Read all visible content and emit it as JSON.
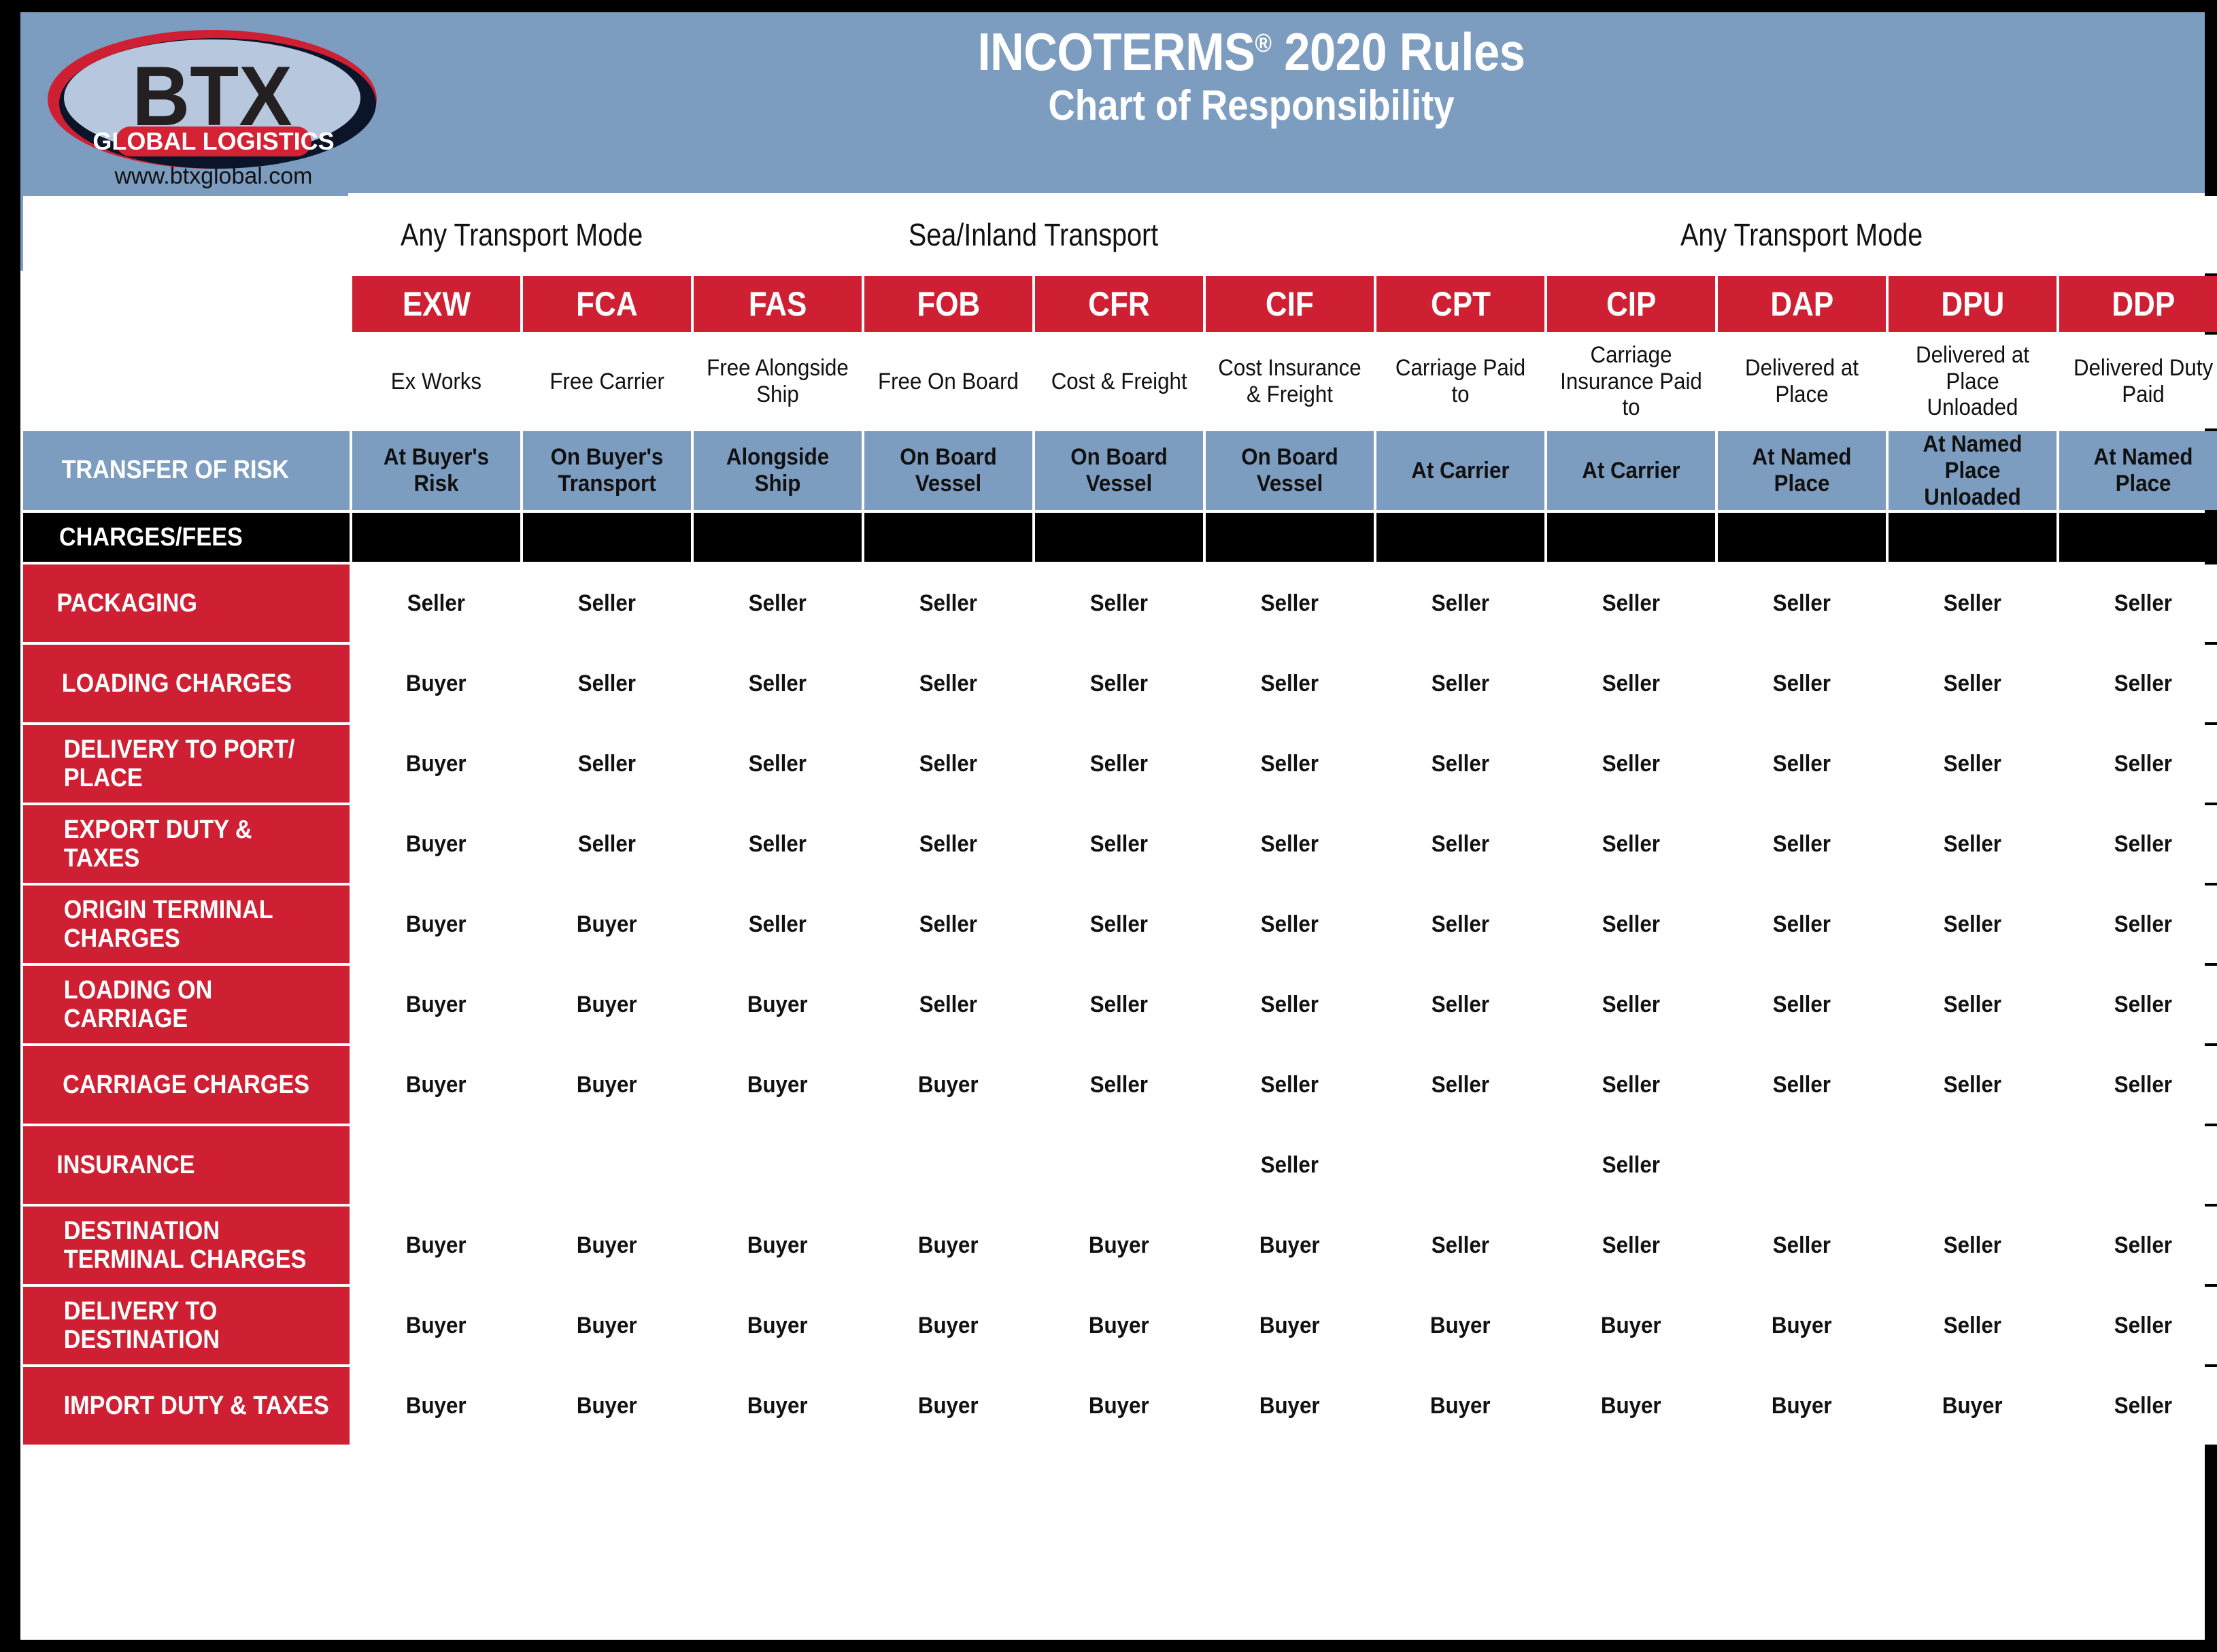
{
  "brand": {
    "name": "BTX",
    "tagline": "GLOBAL LOGISTICS",
    "website": "www.btxglobal.com",
    "colors": {
      "red": "#cf1f32",
      "navy": "#0b1428",
      "blue": "#7d9dc0",
      "gray": "#929497",
      "dark": "#404040"
    }
  },
  "header": {
    "title": "INCOTERMS",
    "title_sup": "®",
    "title_year": " 2020 Rules",
    "subtitle": "Chart of Responsibility"
  },
  "chart_data": {
    "type": "table",
    "title": "INCOTERMS® 2020 Rules — Chart of Responsibility",
    "groups": [
      {
        "label": "Any Transport Mode",
        "span": 2
      },
      {
        "label": "Sea/Inland Transport",
        "span": 4
      },
      {
        "label": "Any Transport Mode",
        "span": 5
      }
    ],
    "codes": [
      "EXW",
      "FCA",
      "FAS",
      "FOB",
      "CFR",
      "CIF",
      "CPT",
      "CIP",
      "DAP",
      "DPU",
      "DDP"
    ],
    "names": [
      "Ex Works",
      "Free Carrier",
      "Free Alongside Ship",
      "Free On Board",
      "Cost & Freight",
      "Cost Insurance & Freight",
      "Carriage Paid to",
      "Carriage Insurance Paid to",
      "Delivered at Place",
      "Delivered at Place Unloaded",
      "Delivered Duty Paid"
    ],
    "transfer_of_risk_label": "TRANSFER OF RISK",
    "transfer_of_risk": [
      "At Buyer's Risk",
      "On Buyer's Transport",
      "Alongside Ship",
      "On Board Vessel",
      "On Board Vessel",
      "On Board Vessel",
      "At Carrier",
      "At Carrier",
      "At Named Place",
      "At Named Place Unloaded",
      "At Named Place"
    ],
    "section_label": "CHARGES/FEES",
    "rows": [
      {
        "label": "PACKAGING",
        "values": [
          "Seller",
          "Seller",
          "Seller",
          "Seller",
          "Seller",
          "Seller",
          "Seller",
          "Seller",
          "Seller",
          "Seller",
          "Seller"
        ]
      },
      {
        "label": "LOADING CHARGES",
        "values": [
          "Buyer",
          "Seller",
          "Seller",
          "Seller",
          "Seller",
          "Seller",
          "Seller",
          "Seller",
          "Seller",
          "Seller",
          "Seller"
        ]
      },
      {
        "label": "DELIVERY TO PORT/ PLACE",
        "values": [
          "Buyer",
          "Seller",
          "Seller",
          "Seller",
          "Seller",
          "Seller",
          "Seller",
          "Seller",
          "Seller",
          "Seller",
          "Seller"
        ]
      },
      {
        "label": "EXPORT DUTY & TAXES",
        "values": [
          "Buyer",
          "Seller",
          "Seller",
          "Seller",
          "Seller",
          "Seller",
          "Seller",
          "Seller",
          "Seller",
          "Seller",
          "Seller"
        ]
      },
      {
        "label": "ORIGIN TERMINAL CHARGES",
        "values": [
          "Buyer",
          "Buyer",
          "Seller",
          "Seller",
          "Seller",
          "Seller",
          "Seller",
          "Seller",
          "Seller",
          "Seller",
          "Seller"
        ]
      },
      {
        "label": "LOADING ON CARRIAGE",
        "values": [
          "Buyer",
          "Buyer",
          "Buyer",
          "Seller",
          "Seller",
          "Seller",
          "Seller",
          "Seller",
          "Seller",
          "Seller",
          "Seller"
        ]
      },
      {
        "label": "CARRIAGE CHARGES",
        "values": [
          "Buyer",
          "Buyer",
          "Buyer",
          "Buyer",
          "Seller",
          "Seller",
          "Seller",
          "Seller",
          "Seller",
          "Seller",
          "Seller"
        ]
      },
      {
        "label": "INSURANCE",
        "values": [
          "",
          "",
          "",
          "",
          "",
          "Seller",
          "",
          "Seller",
          "",
          "",
          ""
        ]
      },
      {
        "label": "DESTINATION TERMINAL CHARGES",
        "values": [
          "Buyer",
          "Buyer",
          "Buyer",
          "Buyer",
          "Buyer",
          "Buyer",
          "Seller",
          "Seller",
          "Seller",
          "Seller",
          "Seller"
        ]
      },
      {
        "label": "DELIVERY TO DESTINATION",
        "values": [
          "Buyer",
          "Buyer",
          "Buyer",
          "Buyer",
          "Buyer",
          "Buyer",
          "Buyer",
          "Buyer",
          "Buyer",
          "Seller",
          "Seller"
        ]
      },
      {
        "label": "IMPORT DUTY & TAXES",
        "values": [
          "Buyer",
          "Buyer",
          "Buyer",
          "Buyer",
          "Buyer",
          "Buyer",
          "Buyer",
          "Buyer",
          "Buyer",
          "Buyer",
          "Seller"
        ]
      }
    ]
  }
}
